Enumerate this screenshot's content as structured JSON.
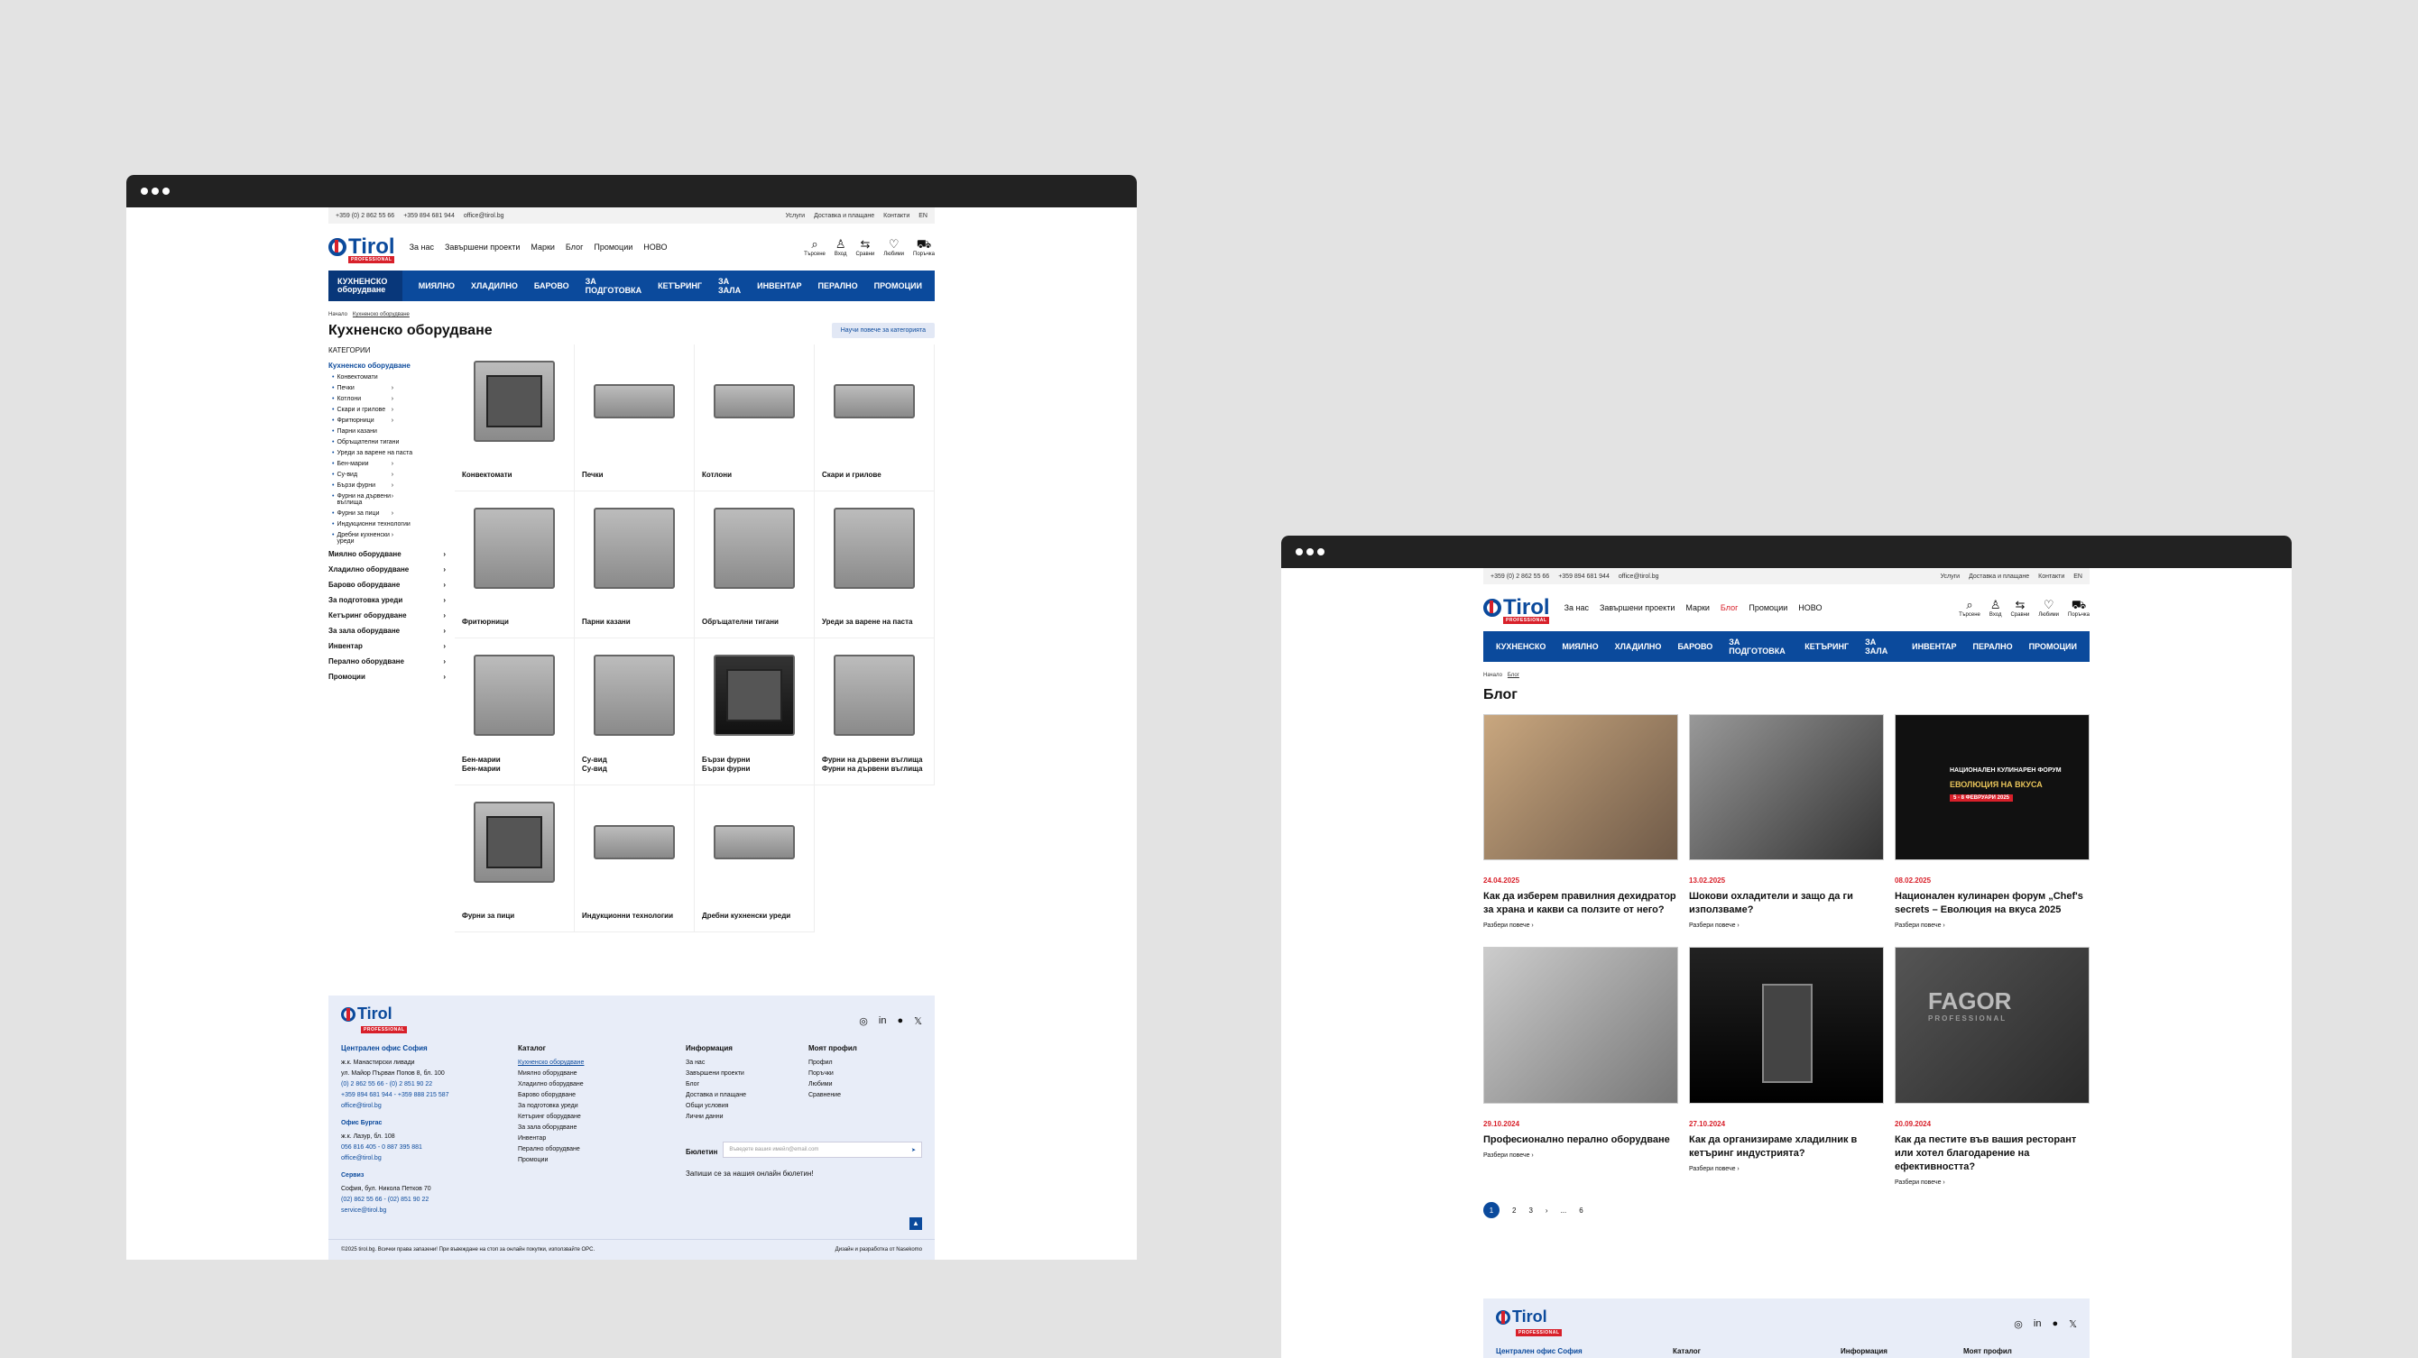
{
  "topbar": {
    "phone1": "+359 (0) 2 862 55 66",
    "phone2": "+359 894 681 944",
    "email": "office@tirol.bg",
    "links": [
      "Услуги",
      "Доставка и плащане",
      "Контакти"
    ],
    "lang": "EN"
  },
  "logo": {
    "name": "Tirol",
    "sub": "PROFESSIONAL"
  },
  "nav": [
    "За нас",
    "Завършени проекти",
    "Марки",
    "Блог",
    "Промоции",
    "НОВО"
  ],
  "icons": [
    {
      "glyph": "search-icon",
      "label": "Търсене"
    },
    {
      "glyph": "user-icon",
      "label": "Вход"
    },
    {
      "glyph": "compare-icon",
      "label": "Сравни"
    },
    {
      "glyph": "heart-icon",
      "label": "Любими"
    },
    {
      "glyph": "cart-icon",
      "label": "Поръчка"
    }
  ],
  "cat_nav_w1": [
    "КУХНЕНСКО оборудване",
    "МИЯЛНО",
    "ХЛАДИЛНО",
    "БАРОВО",
    "ЗА ПОДГОТОВКА",
    "КЕТЪРИНГ",
    "ЗА ЗАЛА",
    "ИНВЕНТАР",
    "ПЕРАЛНО",
    "ПРОМОЦИИ"
  ],
  "cat_nav_w2": [
    "КУХНЕНСКО",
    "МИЯЛНО",
    "ХЛАДИЛНО",
    "БАРОВО",
    "ЗА ПОДГОТОВКА",
    "КЕТЪРИНГ",
    "ЗА ЗАЛА",
    "ИНВЕНТАР",
    "ПЕРАЛНО",
    "ПРОМОЦИИ"
  ],
  "page1": {
    "crumb": [
      "Начало",
      "Кухненско оборудване"
    ],
    "title": "Кухненско оборудване",
    "learn": "Научи повече за категорията",
    "sidebar_title": "КАТЕГОРИИ",
    "sidebar_active": "Кухненско оборудване",
    "sidebar_sub": [
      "Конвектомати",
      "Печки",
      "Котлони",
      "Скари и грилове",
      "Фритюрници",
      "Парни казани",
      "Обръщателни тигани",
      "Уреди за варене на паста",
      "Бен-марии",
      "Су-вид",
      "Бързи фурни",
      "Фурни на дървени въглища",
      "Фурни за пици",
      "Индукционни технологии",
      "Дребни кухненски уреди"
    ],
    "sidebar_main": [
      "Миялно оборудване",
      "Хладилно оборудване",
      "Барово оборудване",
      "За подготовка уреди",
      "Кетъринг оборудване",
      "За зала оборудване",
      "Инвентар",
      "Перално оборудване",
      "Промоции"
    ],
    "products": [
      "Конвектомати",
      "Печки",
      "Котлони",
      "Скари и грилове",
      "Фритюрници",
      "Парни казани",
      "Обръщателни тигани",
      "Уреди за варене на паста",
      "Бен-марии\nБен-марии",
      "Су-вид\nСу-вид",
      "Бързи фурни\nБързи фурни",
      "Фурни на дървени въглища\nФурни на дървени въглища",
      "Фурни за пици",
      "Индукционни технологии",
      "Дребни кухненски уреди"
    ]
  },
  "footer": {
    "office_title": "Централен офис София",
    "office": [
      "ж.к. Манастирски ливади",
      "ул. Майор Първан Попов 8, бл. 100",
      "(0) 2 862 55 66 - (0) 2 851 90 22",
      "+359 894 681 944 - +359 888 215 587",
      "office@tirol.bg"
    ],
    "burgas_title": "Офис Бургас",
    "burgas": [
      "ж.к. Лазур, бл. 108",
      "056 816 405 - 0 887 395 881",
      "office@tirol.bg"
    ],
    "service_title": "Сервиз",
    "service": [
      "София, бул. Никола Петков 70",
      "(02) 862 55 66 - (02) 851 90 22",
      "service@tirol.bg"
    ],
    "catalog_title": "Каталог",
    "catalog": [
      "Кухненско оборудване",
      "Миялно оборудване",
      "Хладилно оборудване",
      "Барово оборудване",
      "За подготовка уреди",
      "Кетъринг оборудване",
      "За зала оборудване",
      "Инвентар",
      "Перално оборудване",
      "Промоции"
    ],
    "info_title": "Информация",
    "info": [
      "За нас",
      "Завършени проекти",
      "Блог",
      "Доставка и плащане",
      "Общи условия",
      "Лични данни"
    ],
    "profile_title": "Моят профил",
    "profile": [
      "Профил",
      "Поръчки",
      "Любими",
      "Сравнение"
    ],
    "newsletter_title": "Бюлетин",
    "newsletter_placeholder": "Въведете вашия имейл@email.com",
    "newsletter_note": "Запиши се за нашия онлайн бюлетин!",
    "copyright": "©2025 tirol.bg. Всички права запазени! При въвеждане на стоп за онлайн покупки, използвайте ОРС.",
    "credit": "Дизайн и разработка от Nasekomo"
  },
  "page2": {
    "crumb": [
      "Начало",
      "Блог"
    ],
    "title": "Блог",
    "posts": [
      {
        "date": "24.04.2025",
        "title": "Как да изберем правилния дехидратор за храна и какви са ползите от него?",
        "more": "Разбери повече"
      },
      {
        "date": "13.02.2025",
        "title": "Шокови охладители и защо да ги използваме?",
        "more": "Разбери повече"
      },
      {
        "date": "08.02.2025",
        "title": "Национален кулинарен форум „Chef's secrets – Еволюция на вкуса 2025",
        "more": "Разбери повече"
      },
      {
        "date": "29.10.2024",
        "title": "Професионално перално оборудване",
        "more": "Разбери повече"
      },
      {
        "date": "27.10.2024",
        "title": "Как да организираме хладилник в кетъринг индустрията?",
        "more": "Разбери повече"
      },
      {
        "date": "20.09.2024",
        "title": "Как да пестите във вашия ресторант или хотел благодарение на ефективността?",
        "more": "Разбери повече"
      }
    ],
    "pages": [
      "1",
      "2",
      "3",
      "›",
      "...",
      "6"
    ],
    "forum_banner": "НАЦИОНАЛЕН КУЛИНАРЕН ФОРУМ",
    "forum_sub": "ЕВОЛЮЦИЯ НА ВКУСА",
    "forum_date": "5 - 8 ФЕВРУАРИ 2025",
    "fagor": "FAGOR",
    "fagor_sub": "PROFESSIONAL"
  },
  "footer2": {
    "office_title": "Централен офис София",
    "catalog_title": "Каталог",
    "info_title": "Информация",
    "profile_title": "Моят профил"
  }
}
